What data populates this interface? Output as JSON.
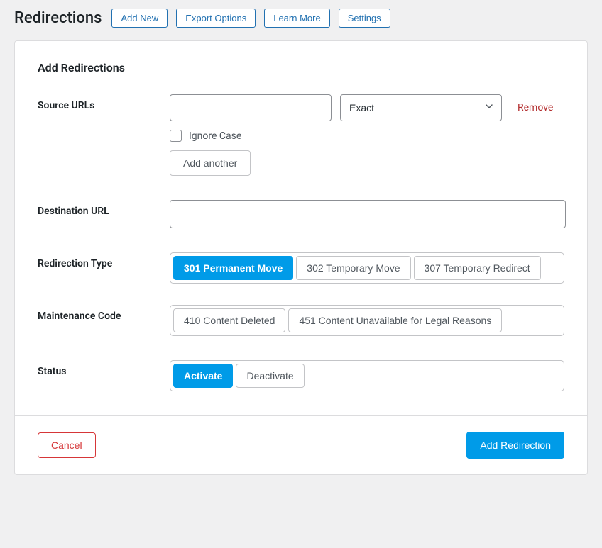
{
  "header": {
    "title": "Redirections",
    "buttons": [
      "Add New",
      "Export Options",
      "Learn More",
      "Settings"
    ]
  },
  "section": {
    "title": "Add Redirections"
  },
  "source": {
    "label": "Source URLs",
    "value": "",
    "match_type_selected": "Exact",
    "remove": "Remove",
    "ignore_case": "Ignore Case",
    "ignore_case_checked": false,
    "add_another": "Add another"
  },
  "destination": {
    "label": "Destination URL",
    "value": ""
  },
  "redirect_type": {
    "label": "Redirection Type",
    "options": [
      "301 Permanent Move",
      "302 Temporary Move",
      "307 Temporary Redirect"
    ],
    "selected": "301 Permanent Move"
  },
  "maintenance": {
    "label": "Maintenance Code",
    "options": [
      "410 Content Deleted",
      "451 Content Unavailable for Legal Reasons"
    ],
    "selected": null
  },
  "status": {
    "label": "Status",
    "options": [
      "Activate",
      "Deactivate"
    ],
    "selected": "Activate"
  },
  "footer": {
    "cancel": "Cancel",
    "submit": "Add Redirection"
  }
}
